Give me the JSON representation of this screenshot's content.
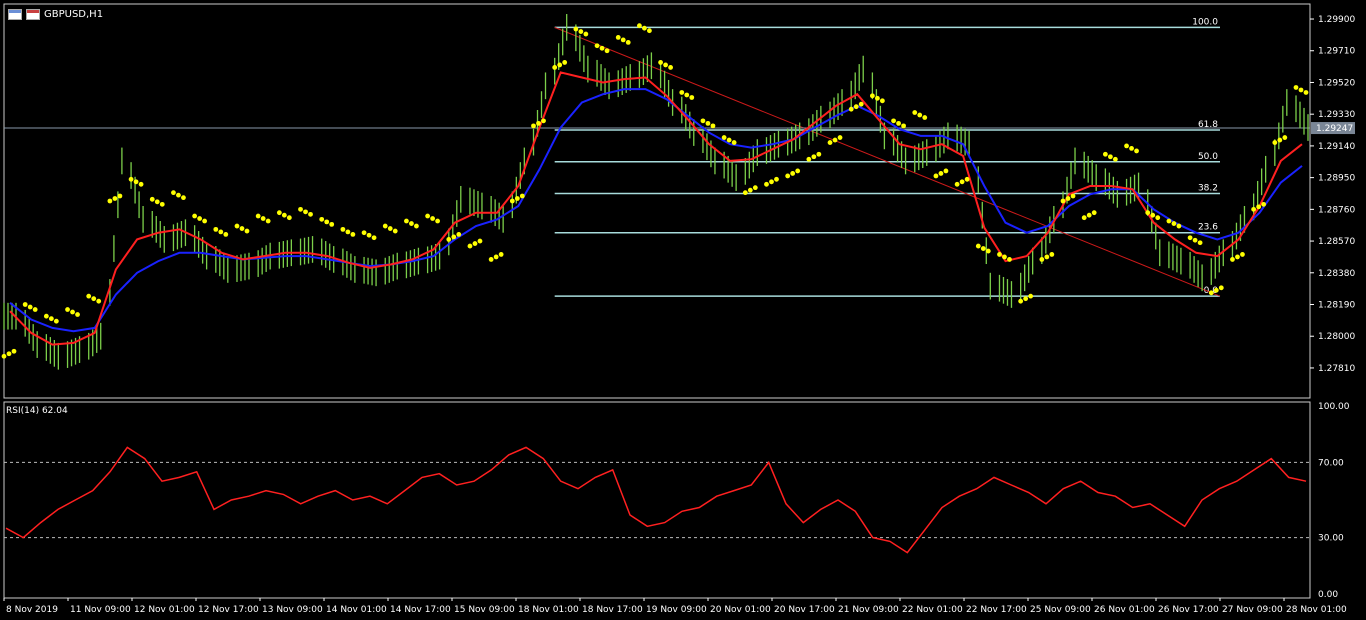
{
  "window": {
    "symbol_label": "GBPUSD,H1"
  },
  "colors": {
    "background": "#000000",
    "candles": "#7ccf4a",
    "ma_fast": "#ff2020",
    "ma_slow": "#1a22ff",
    "sar": "#ffff00",
    "fib": "#a8dcdc",
    "trendline": "#cc1a1a",
    "rsi": "#ff2020",
    "grid_dotted": "#bbbbbb",
    "axis": "#ffffff"
  },
  "chart_data": [
    {
      "type": "line",
      "name": "price",
      "symbol": "GBPUSD",
      "timeframe": "H1",
      "ylim": [
        1.2763,
        1.2999
      ],
      "yticks": [
        "1.29900",
        "1.29710",
        "1.29520",
        "1.29330",
        "1.29140",
        "1.28950",
        "1.28760",
        "1.28570",
        "1.28380",
        "1.28190",
        "1.28000",
        "1.27810"
      ],
      "current_price": "1.29247",
      "x_ticks": [
        "8 Nov 2019",
        "11 Nov 09:00",
        "12 Nov 01:00",
        "12 Nov 17:00",
        "13 Nov 09:00",
        "14 Nov 01:00",
        "14 Nov 17:00",
        "15 Nov 09:00",
        "18 Nov 01:00",
        "18 Nov 17:00",
        "19 Nov 09:00",
        "20 Nov 01:00",
        "20 Nov 17:00",
        "21 Nov 09:00",
        "22 Nov 01:00",
        "22 Nov 17:00",
        "25 Nov 09:00",
        "26 Nov 01:00",
        "26 Nov 17:00",
        "27 Nov 09:00",
        "28 Nov 01:00"
      ],
      "close": [
        1.2812,
        1.2795,
        1.2788,
        1.2792,
        1.28,
        1.2905,
        1.287,
        1.2858,
        1.2862,
        1.2848,
        1.284,
        1.2842,
        1.2848,
        1.285,
        1.2852,
        1.2846,
        1.284,
        1.2838,
        1.2842,
        1.2845,
        1.2848,
        1.2882,
        1.2878,
        1.287,
        1.2905,
        1.295,
        1.2985,
        1.296,
        1.295,
        1.2955,
        1.2962,
        1.294,
        1.2922,
        1.2905,
        1.2895,
        1.291,
        1.2915,
        1.292,
        1.293,
        1.294,
        1.296,
        1.292,
        1.2905,
        1.291,
        1.292,
        1.2915,
        1.283,
        1.2825,
        1.2845,
        1.287,
        1.2905,
        1.2895,
        1.2885,
        1.289,
        1.285,
        1.2845,
        1.2835,
        1.285,
        1.287,
        1.29,
        1.294,
        1.2925
      ],
      "ma_fast": [
        1.2815,
        1.2802,
        1.2795,
        1.2796,
        1.2802,
        1.284,
        1.2858,
        1.2862,
        1.2864,
        1.2858,
        1.285,
        1.2846,
        1.2848,
        1.285,
        1.285,
        1.2848,
        1.2844,
        1.2841,
        1.2843,
        1.2846,
        1.2852,
        1.2868,
        1.2874,
        1.2874,
        1.289,
        1.2925,
        1.2958,
        1.2955,
        1.2952,
        1.2954,
        1.2955,
        1.2944,
        1.293,
        1.2915,
        1.2905,
        1.2906,
        1.2912,
        1.2918,
        1.2928,
        1.2938,
        1.2945,
        1.293,
        1.2915,
        1.2912,
        1.2915,
        1.2908,
        1.2865,
        1.2845,
        1.2848,
        1.2862,
        1.2885,
        1.289,
        1.289,
        1.2888,
        1.2868,
        1.2858,
        1.285,
        1.2848,
        1.2858,
        1.2878,
        1.2905,
        1.2915
      ],
      "ma_slow": [
        1.282,
        1.281,
        1.2805,
        1.2803,
        1.2805,
        1.2825,
        1.2838,
        1.2845,
        1.285,
        1.285,
        1.2848,
        1.2846,
        1.2847,
        1.2848,
        1.2848,
        1.2846,
        1.2844,
        1.2842,
        1.2843,
        1.2845,
        1.2848,
        1.2858,
        1.2866,
        1.287,
        1.2878,
        1.29,
        1.2925,
        1.294,
        1.2945,
        1.2948,
        1.2948,
        1.2942,
        1.2932,
        1.2922,
        1.2915,
        1.2913,
        1.2915,
        1.2918,
        1.2925,
        1.2932,
        1.2938,
        1.2932,
        1.2924,
        1.292,
        1.292,
        1.2915,
        1.289,
        1.2868,
        1.2862,
        1.2866,
        1.2878,
        1.2885,
        1.2888,
        1.2888,
        1.2876,
        1.2868,
        1.2862,
        1.2858,
        1.2862,
        1.2874,
        1.2892,
        1.2902
      ],
      "rsi": {
        "name": "RSI(14) 62.04",
        "period": 14,
        "value": "62.04",
        "ylim": [
          0,
          100
        ],
        "yticks": [
          "100.00",
          "70.00",
          "30.00",
          "0.00"
        ],
        "levels": [
          70,
          30
        ],
        "values": [
          35,
          30,
          38,
          45,
          50,
          55,
          65,
          78,
          72,
          60,
          62,
          65,
          45,
          50,
          52,
          55,
          53,
          48,
          52,
          55,
          50,
          52,
          48,
          55,
          62,
          64,
          58,
          60,
          66,
          74,
          78,
          72,
          60,
          56,
          62,
          66,
          42,
          36,
          38,
          44,
          46,
          52,
          55,
          58,
          70,
          48,
          38,
          45,
          50,
          44,
          30,
          28,
          22,
          34,
          46,
          52,
          56,
          62,
          58,
          54,
          48,
          56,
          60,
          54,
          52,
          46,
          48,
          42,
          36,
          50,
          56,
          60,
          66,
          72,
          62,
          60
        ]
      },
      "fibonacci": {
        "levels": [
          "100.0",
          "61.8",
          "50.0",
          "38.2",
          "23.6",
          "0.0"
        ],
        "high": 1.2985,
        "low": 1.2824
      }
    }
  ]
}
